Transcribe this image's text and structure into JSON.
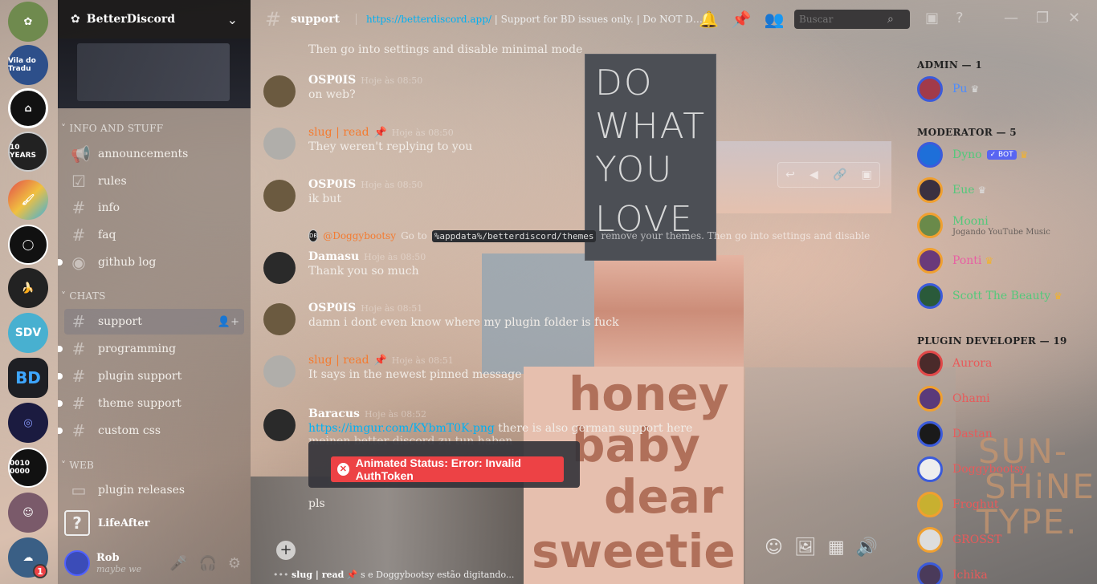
{
  "guild": {
    "name": "BetterDiscord",
    "categories": [
      {
        "label": "INFO AND STUFF"
      },
      {
        "label": "CHATS"
      },
      {
        "label": "WEB"
      }
    ],
    "channels": [
      {
        "label": "announcements"
      },
      {
        "label": "rules"
      },
      {
        "label": "info"
      },
      {
        "label": "faq"
      },
      {
        "label": "github log"
      },
      {
        "label": "support"
      },
      {
        "label": "programming"
      },
      {
        "label": "plugin support"
      },
      {
        "label": "theme support"
      },
      {
        "label": "custom css"
      },
      {
        "label": "plugin releases"
      }
    ],
    "voice_channel": "LifeAfter"
  },
  "servers": [
    {
      "label": "Vila do Tradu"
    },
    {
      "label": "10 YEARS"
    },
    {
      "label": "SDV"
    },
    {
      "label": "BD"
    },
    {
      "label": "0010 0000"
    }
  ],
  "user": {
    "name": "Rob",
    "status": "maybe we",
    "mentions": "1"
  },
  "header": {
    "channel": "support",
    "topic_link": "https://betterdiscord.app/",
    "topic_text": " | Support for BD issues only. | Do NOT DM mods/use...",
    "search_placeholder": "Buscar"
  },
  "messages": [
    {
      "author": "",
      "time": "",
      "text": "Then go into settings and disable minimal mode"
    },
    {
      "author": "OSP0IS",
      "time": "Hoje às 08:50",
      "text": "on web?"
    },
    {
      "author": "slug | read",
      "time": "Hoje às 08:50",
      "text": "They weren't replying to you"
    },
    {
      "author": "OSP0IS",
      "time": "Hoje às 08:50",
      "text": "ik but"
    },
    {
      "author": "Damasu",
      "time": "Hoje às 08:50",
      "text": "Thank you so much"
    },
    {
      "author": "OSP0IS",
      "time": "Hoje às 08:51",
      "text": "damn i dont even know where my plugin folder is fuck"
    },
    {
      "author": "slug | read",
      "time": "Hoje às 08:51",
      "text": "It says in the newest pinned message"
    },
    {
      "author": "Baracus",
      "time": "Hoje às 08:52",
      "link": "https://imgur.com/KYbmT0K.png",
      "text": " there is also german support here"
    },
    {
      "author": "",
      "time": "",
      "text": "pls"
    }
  ],
  "reply": {
    "author": "@Doggybootsy",
    "prefix": "Go to ",
    "code": "%appdata%/betterdiscord/themes",
    "suffix": " remove your themes. Then go into settings and disable minimal..."
  },
  "ghost_text": "meinen better discord zu tun haben",
  "toast": "Animated Status: Error: Invalid AuthToken",
  "typing": {
    "user": "slug | read",
    "rest": "s e Doggybootsy estão digitando..."
  },
  "neon_sign": [
    "DO",
    "WHAT",
    "YOU",
    "LOVE"
  ],
  "honey_sign": [
    "honey",
    "baby",
    "dear",
    "sweetie"
  ],
  "sunshine_sign": [
    "SUN-",
    "SHiNE",
    "TYPE."
  ],
  "members": {
    "roles": [
      {
        "label": "ADMIN — 1"
      },
      {
        "label": "MODERATOR — 5"
      },
      {
        "label": "PLUGIN DEVELOPER — 19"
      }
    ],
    "list": [
      {
        "name": "Pu",
        "color": "#4c8cff"
      },
      {
        "name": "Dyno",
        "color": "#52c97a",
        "bot": "✓ BOT"
      },
      {
        "name": "Eue",
        "color": "#52c97a"
      },
      {
        "name": "Mooni",
        "color": "#52c97a",
        "sub": "Jogando YouTube Music"
      },
      {
        "name": "Ponti",
        "color": "#e85fa3"
      },
      {
        "name": "Scott The Beauty",
        "color": "#52c97a"
      },
      {
        "name": "Aurora",
        "color": "#e85a5a"
      },
      {
        "name": "Ohami",
        "color": "#e85a5a"
      },
      {
        "name": "Dastan",
        "color": "#e85a5a"
      },
      {
        "name": "Doggybootsy",
        "color": "#e85a5a"
      },
      {
        "name": "Froghut",
        "color": "#e85a5a"
      },
      {
        "name": "GROSST",
        "color": "#e85a5a"
      },
      {
        "name": "Ichika",
        "color": "#e85a5a"
      }
    ]
  },
  "colors": {
    "accent": "#5865f2",
    "danger": "#ed4245",
    "link": "#00b0f4",
    "orange_name": "#f47b30"
  }
}
